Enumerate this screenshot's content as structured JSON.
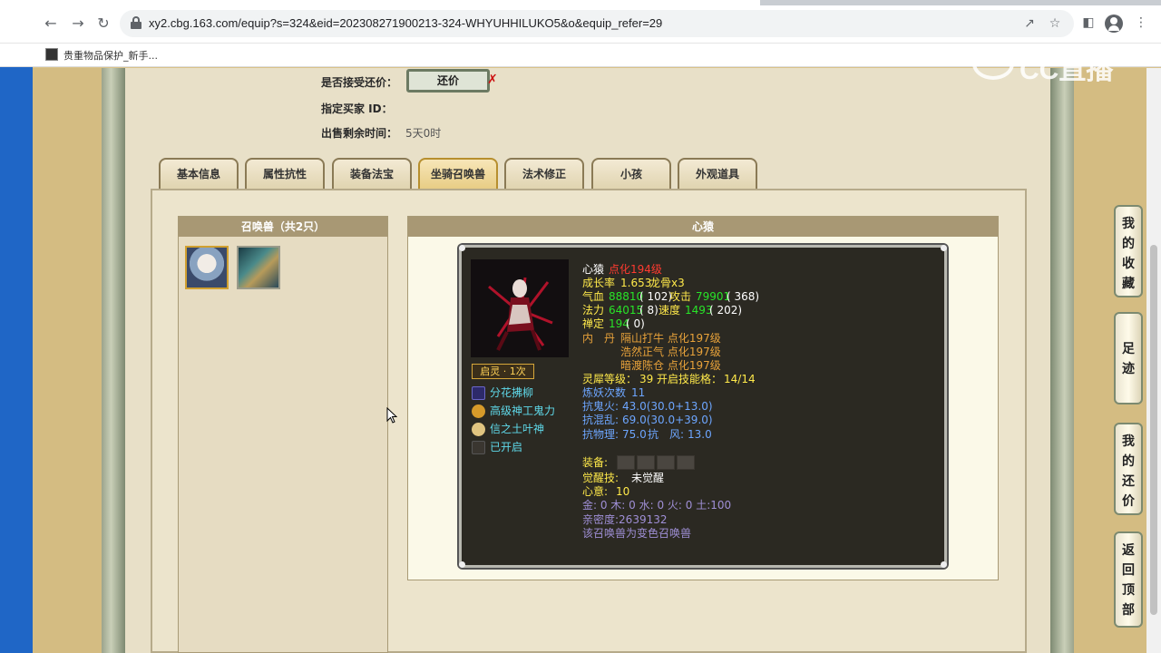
{
  "browser": {
    "url": "xy2.cbg.163.com/equip?s=324&eid=202308271900213-324-WHYUHHILUKO5&o&equip_refer=29",
    "bookmark_label": "贵重物品保护_新手..."
  },
  "watermark": "CC直播",
  "top_info": {
    "accept_counter_label": "是否接受还价：",
    "counter_button": "还价",
    "buyer_id_label": "指定买家 ID：",
    "remaining_label": "出售剩余时间：",
    "remaining_value": "5天0时"
  },
  "tabs": [
    {
      "label": "基本信息",
      "active": false
    },
    {
      "label": "属性抗性",
      "active": false
    },
    {
      "label": "装备法宝",
      "active": false
    },
    {
      "label": "坐骑召唤兽",
      "active": true
    },
    {
      "label": "法术修正",
      "active": false
    },
    {
      "label": "小孩",
      "active": false
    },
    {
      "label": "外观道具",
      "active": false
    }
  ],
  "summon_panel": {
    "header": "召唤兽（共2只）"
  },
  "detail": {
    "header": "心猿",
    "name": "心猿",
    "name_tag": "点化194级",
    "growth_label": "成长率",
    "growth_value": "1.653",
    "dragon_bone": "龙骨x3",
    "hp_label": "气血",
    "hp_value": "88810",
    "hp_extra": "( 102)",
    "atk_label": "攻击",
    "atk_value": "79901",
    "atk_extra": "( 368)",
    "mana_label": "法力",
    "mana_value": "64015",
    "mana_extra": "( 8)",
    "speed_label": "速度",
    "speed_value": "1493",
    "speed_extra": "( 202)",
    "zen_label": "禅定",
    "zen_value": "194",
    "zen_extra": "( 0)",
    "neidan_label": "内　丹",
    "neidan": [
      "隔山打牛 点化197级",
      "浩然正气 点化197级",
      "暗渡陈仓 点化197级"
    ],
    "lingxi_text": "灵犀等级：",
    "lingxi_level": "39",
    "skill_slots_label": "开启技能格：",
    "skill_slots_value": "14/14",
    "refine_label": "炼妖次数",
    "refine_value": "11",
    "resist_fire_label": "抗鬼火:",
    "resist_fire_value": "43.0(30.0+13.0)",
    "resist_chaos_label": "抗混乱:",
    "resist_chaos_value": "69.0(30.0+39.0)",
    "resist_phys_label": "抗物理:",
    "resist_phys_value": "75.0",
    "resist_wind_label": "抗　风:",
    "resist_wind_value": "13.0",
    "equip_label": "装备:",
    "awaken_label": "觉醒技:",
    "awaken_value": "未觉醒",
    "heart_label": "心意:",
    "heart_value": "10",
    "elements": "金: 0 木: 0 水: 0 火: 0 土:100",
    "intimacy": "亲密度:2639132",
    "variant_note": "该召唤兽为变色召唤兽",
    "spirit_tag": "启灵 · 1次",
    "skills": [
      {
        "label": "分花拂柳",
        "icon": "skill-icon-purple"
      },
      {
        "label": "高级神工鬼力",
        "icon": "skill-icon-gold"
      },
      {
        "label": "信之土叶神",
        "icon": "skill-icon-yellow"
      },
      {
        "label": "已开启",
        "icon": "skill-icon-dark"
      }
    ]
  },
  "side_buttons": [
    {
      "label": "我的收藏",
      "chars": [
        "我",
        "的",
        "收",
        "藏"
      ]
    },
    {
      "label": "足迹",
      "chars": [
        "足",
        "迹"
      ]
    },
    {
      "label": "我的还价",
      "chars": [
        "我",
        "的",
        "还",
        "价"
      ]
    },
    {
      "label": "返回顶部",
      "chars": [
        "返",
        "回",
        "顶",
        "部"
      ]
    }
  ]
}
